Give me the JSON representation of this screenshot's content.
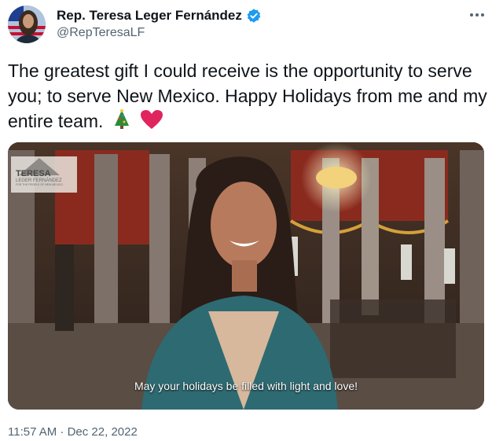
{
  "author": {
    "display_name": "Rep. Teresa Leger Fernández",
    "handle": "@RepTeresaLF",
    "verified_icon": "verified-badge-icon",
    "avatar_icon": "avatar"
  },
  "more_icon": "more-options-icon",
  "tweet": {
    "text": "The greatest gift I could receive is the opportunity to serve you; to serve New Mexico. Happy Holidays from me and my entire team.",
    "emojis": [
      "christmas-tree",
      "red-heart"
    ]
  },
  "video": {
    "logo_text": "TERESA",
    "logo_subtext": "LEGER FERNÁNDEZ",
    "logo_tagline": "FOR THE PEOPLE OF NEW MEXICO",
    "caption": "May your holidays be filled with light and love!"
  },
  "timestamp": "11:57 AM · Dec 22, 2022",
  "colors": {
    "text": "#0f1419",
    "secondary": "#536471",
    "verified": "#1d9bf0"
  }
}
